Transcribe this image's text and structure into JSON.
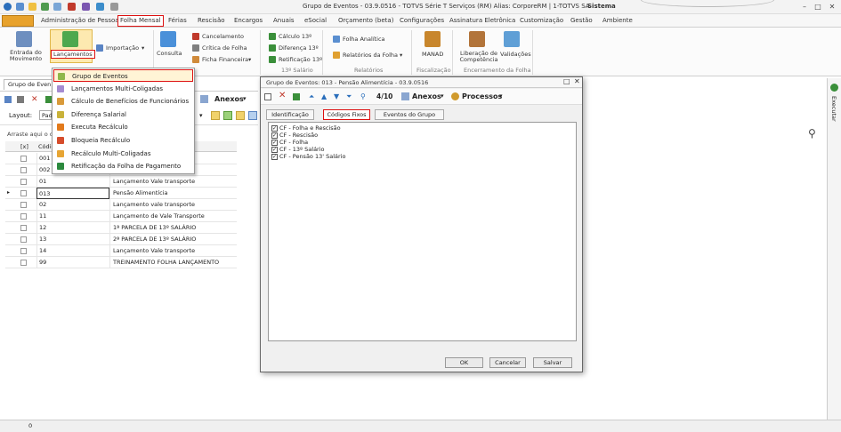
{
  "window": {
    "title": "Grupo de Eventos - 03.9.0516 - TOTVS Série T Serviços (RM) Alias: CorporeRM | 1-TOTVS SA",
    "system_label": "Sistema"
  },
  "menu": {
    "tabs": [
      "Administração de Pessoal",
      "Folha Mensal",
      "Férias",
      "Rescisão",
      "Encargos",
      "Anuais",
      "eSocial",
      "Orçamento (beta)",
      "Configurações",
      "Assinatura Eletrônica",
      "Customização",
      "Gestão",
      "Ambiente"
    ],
    "active": "Folha Mensal"
  },
  "ribbon": {
    "entrada_label": "Entrada do Movimento",
    "lancamentos_label": "Lançamentos",
    "importacao_label": "Importação",
    "consulta_label": "Consulta",
    "cancelamento_label": "Cancelamento",
    "critica_label": "Crítica de Folha",
    "ficha_label": "Ficha Financeira",
    "calculo13_label": "Cálculo 13º",
    "diferenca13_label": "Diferença 13º",
    "retificacao13_label": "Retificação 13º",
    "group_13": "13º Salário",
    "folha_analitica_label": "Folha Analítica",
    "relatorios_folha_label": "Relatórios da Folha",
    "group_relatorios": "Relatórios",
    "manad_label": "MANAD",
    "group_fiscalizacao": "Fiscalização",
    "liberacao_label": "Liberação de Competência",
    "validacoes_label": "Validações",
    "group_encerramento": "Encerramento da Folha"
  },
  "dropdown": {
    "items": [
      {
        "label": "Grupo de Eventos",
        "color": "#8fb84a"
      },
      {
        "label": "Lançamentos Multi-Coligadas",
        "color": "#a58bd1"
      },
      {
        "label": "Cálculo de Benefícios de Funcionários",
        "color": "#d99a3a"
      },
      {
        "label": "Diferença Salarial",
        "color": "#c9b23a"
      },
      {
        "label": "Executa Recálculo",
        "color": "#e27a1c"
      },
      {
        "label": "Bloqueia Recálculo",
        "color": "#d64d2c"
      },
      {
        "label": "Recálculo Multi-Coligadas",
        "color": "#e7a534"
      },
      {
        "label": "Retificação da Folha de Pagamento",
        "color": "#2c8a3e"
      }
    ],
    "highlighted": "Grupo de Eventos"
  },
  "leftpanel": {
    "doc_tab": "Grupo de Even",
    "layout_label": "Layout:",
    "layout_value": "Pad",
    "group_hint": "Arraste aqui o ca",
    "col_x": "[x]",
    "col_code": "Códig",
    "rows": [
      {
        "code": "001",
        "desc": ""
      },
      {
        "code": "002",
        "desc": ""
      },
      {
        "code": "01",
        "desc": "Lançamento Vale transporte"
      },
      {
        "code": "013",
        "desc": "Pensão Alimentícia"
      },
      {
        "code": "02",
        "desc": "Lançamento vale transporte"
      },
      {
        "code": "11",
        "desc": "Lançamento de Vale Transporte"
      },
      {
        "code": "12",
        "desc": "1ª PARCELA DE 13º SALÁRIO"
      },
      {
        "code": "13",
        "desc": "2ª PARCELA DE 13º SALÁRIO"
      },
      {
        "code": "14",
        "desc": "Lançamento Vale transporte"
      },
      {
        "code": "99",
        "desc": "TREINAMENTO FOLHA LANÇAMENTO"
      }
    ],
    "anexos": "Anexos",
    "status_count": "0"
  },
  "dialog": {
    "title": "Grupo de Eventos: 013 - Pensão Alimentícia - 03.9.0516",
    "record_pos": "4/10",
    "anexos": "Anexos",
    "processos": "Processos",
    "tabs": [
      "Identificação",
      "Códigos Fixos",
      "Eventos do Grupo"
    ],
    "active_tab": "Códigos Fixos",
    "items": [
      "CF - Folha e Rescisão",
      "CF - Rescisão",
      "CF - Folha",
      "CF - 13º Salário",
      "CF - Pensão 13' Salário"
    ],
    "ok": "OK",
    "cancel": "Cancelar",
    "save": "Salvar"
  },
  "rightstrip": {
    "label": "Executar"
  }
}
